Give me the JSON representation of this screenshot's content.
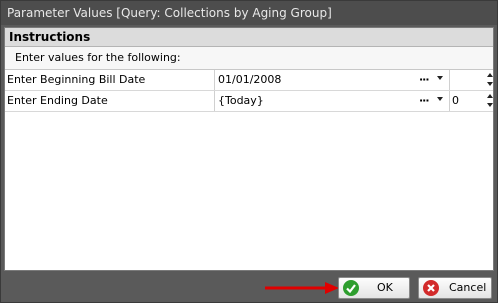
{
  "window": {
    "title": "Parameter Values [Query: Collections by Aging Group]"
  },
  "instructions": {
    "header": "Instructions",
    "text": "Enter values for the following:"
  },
  "parameters": [
    {
      "label": "Enter Beginning Bill Date",
      "value": "01/01/2008",
      "spin_value": ""
    },
    {
      "label": "Enter Ending Date",
      "value": "{Today}",
      "spin_value": "0"
    }
  ],
  "buttons": {
    "ok_label": "OK",
    "cancel_label": "Cancel"
  },
  "icons": {
    "ok": "check-circle-icon",
    "cancel": "x-circle-icon",
    "more": "ellipsis-icon",
    "dropdown": "chevron-down-icon",
    "annotation": "red-arrow-icon"
  },
  "colors": {
    "ok_icon": "#2e9e2e",
    "cancel_icon": "#d22a2a",
    "annotation_arrow": "#e00000"
  }
}
